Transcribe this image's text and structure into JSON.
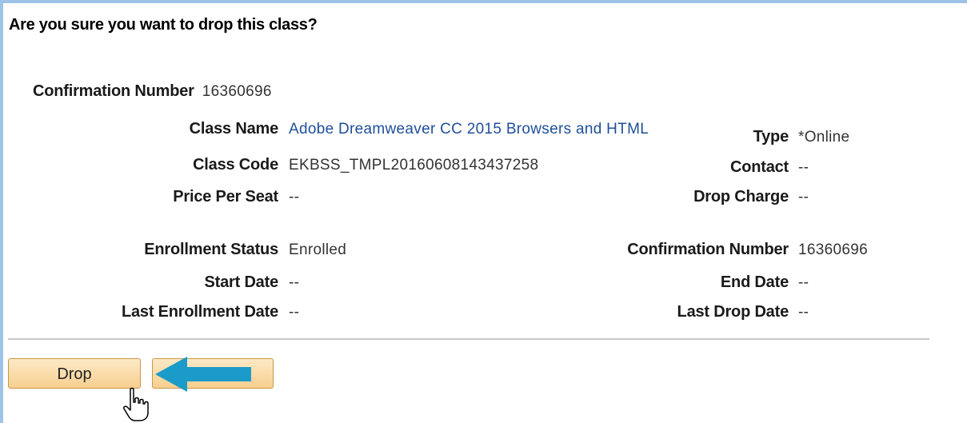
{
  "dialog": {
    "heading": "Are you sure you want to drop this class?",
    "confirmation_label": "Confirmation Number",
    "confirmation_value": "16360696"
  },
  "details": {
    "class_name_label": "Class Name",
    "class_name_value": "Adobe Dreamweaver CC 2015 Browsers and HTML",
    "type_label": "Type",
    "type_value": "*Online",
    "class_code_label": "Class Code",
    "class_code_value": "EKBSS_TMPL20160608143437258",
    "contact_label": "Contact",
    "contact_value": "--",
    "price_label": "Price Per Seat",
    "price_value": "--",
    "drop_charge_label": "Drop Charge",
    "drop_charge_value": "--",
    "enrollment_status_label": "Enrollment Status",
    "enrollment_status_value": "Enrolled",
    "confirmation_label": "Confirmation Number",
    "confirmation_value": "16360696",
    "start_date_label": "Start Date",
    "start_date_value": "--",
    "end_date_label": "End Date",
    "end_date_value": "--",
    "last_enrollment_label": "Last Enrollment Date",
    "last_enrollment_value": "--",
    "last_drop_label": "Last Drop Date",
    "last_drop_value": "--"
  },
  "actions": {
    "drop_label": "Drop",
    "second_label": ""
  },
  "colors": {
    "arrow": "#1b9bc9",
    "link": "#1f4f9a",
    "button_fill": "#f7cf8f"
  },
  "icons": {
    "arrow": "left-arrow-icon",
    "cursor": "hand-pointer-icon"
  }
}
